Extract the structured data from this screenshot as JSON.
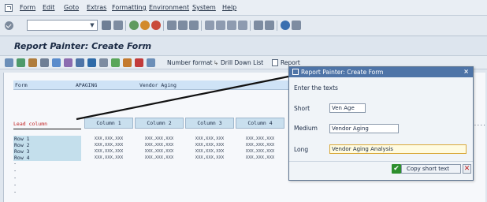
{
  "menu": {
    "items": [
      "Form",
      "Edit",
      "Goto",
      "Extras",
      "Formatting",
      "Environment",
      "System",
      "Help"
    ]
  },
  "std_toolbar": {
    "command_field": ""
  },
  "page": {
    "title": "Report Painter: Create Form"
  },
  "app_toolbar": {
    "number_format": "Number format",
    "drill_down_list": "Drill Down List",
    "report": "Report"
  },
  "form_grid": {
    "form_label": "Form",
    "form_code": "APAGING",
    "form_desc": "Vendor Aging",
    "lead_column": "Lead column",
    "columns": [
      "Column 1",
      "Column 2",
      "Column 3",
      "Column 4"
    ],
    "rows": [
      "Row 1",
      "Row 2",
      "Row 3",
      "Row 4"
    ],
    "cell_value": "XXX,XXX,XXX",
    "more": "...."
  },
  "dialog": {
    "title": "Report Painter: Create Form",
    "instruction": "Enter the texts",
    "short_label": "Short",
    "short_value": "Ven Age",
    "medium_label": "Medium",
    "medium_value": "Vendor Aging",
    "long_label": "Long",
    "long_value": "Vendor Aging Analysis",
    "copy_button": "Copy short text"
  },
  "colors": {
    "title_bar": "#4e74a7",
    "lead_text": "#c02020",
    "header_bg": "#cfe3f6"
  }
}
